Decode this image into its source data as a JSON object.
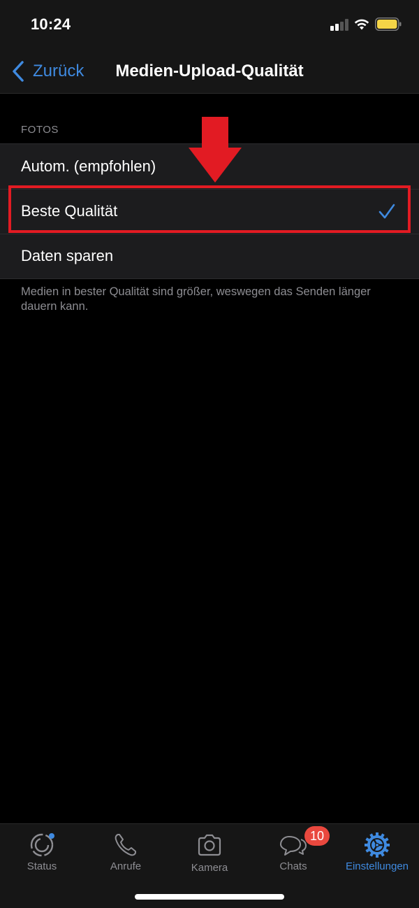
{
  "status_bar": {
    "time": "10:24",
    "signal_bars_active": 2,
    "signal_bars_total": 4,
    "battery_color": "#f5d547"
  },
  "nav": {
    "back_label": "Zurück",
    "title": "Medien-Upload-Qualität"
  },
  "section": {
    "header": "FOTOS",
    "options": [
      {
        "label": "Autom. (empfohlen)",
        "selected": false
      },
      {
        "label": "Beste Qualität",
        "selected": true
      },
      {
        "label": "Daten sparen",
        "selected": false
      }
    ],
    "footer": "Medien in bester Qualität sind größer, weswegen das Senden länger dauern kann."
  },
  "annotation": {
    "color": "#e21b23",
    "highlighted_option": "Beste Qualität"
  },
  "tab_bar": {
    "tabs": [
      {
        "label": "Status",
        "icon": "status-icon",
        "active": false
      },
      {
        "label": "Anrufe",
        "icon": "phone-icon",
        "active": false
      },
      {
        "label": "Kamera",
        "icon": "camera-icon",
        "active": false
      },
      {
        "label": "Chats",
        "icon": "chats-icon",
        "active": false
      },
      {
        "label": "Einstellungen",
        "icon": "settings-icon",
        "active": true
      }
    ],
    "chats_badge": "10",
    "accent_color": "#3f8ae0",
    "badge_color": "#e9483e"
  }
}
